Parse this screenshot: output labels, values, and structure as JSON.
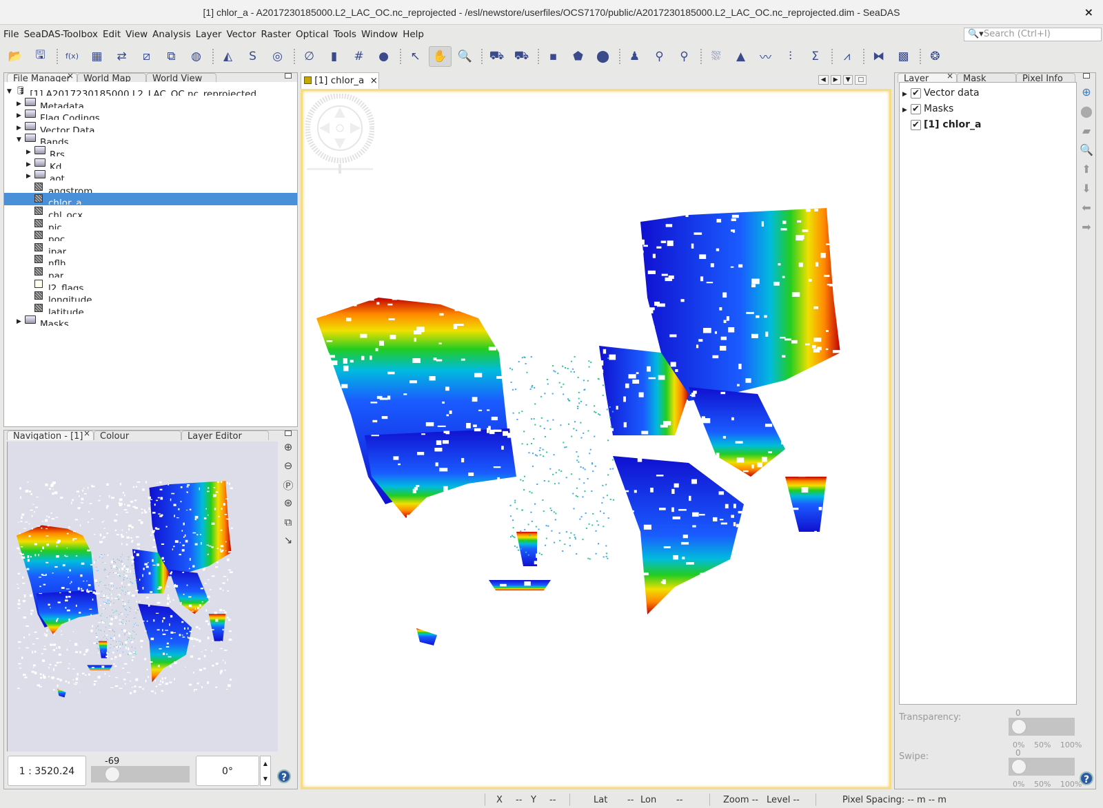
{
  "window": {
    "title": "[1] chlor_a - A2017230185000.L2_LAC_OC.nc_reprojected - /esl/newstore/userfiles/OCS7170/public/A2017230185000.L2_LAC_OC.nc_reprojected.dim - SeaDAS",
    "close": "×"
  },
  "menu": [
    "File",
    "SeaDAS-Toolbox",
    "Edit",
    "View",
    "Analysis",
    "Layer",
    "Vector",
    "Raster",
    "Optical",
    "Tools",
    "Window",
    "Help"
  ],
  "search": {
    "placeholder": "Search (Ctrl+I)"
  },
  "toolbar": [
    {
      "name": "open-product-icon",
      "glyph": "📂"
    },
    {
      "name": "save-product-icon",
      "glyph": "🖫"
    },
    {
      "sep": true
    },
    {
      "name": "band-maths-icon",
      "glyph": "f(x)"
    },
    {
      "name": "grid-icon",
      "glyph": "▦"
    },
    {
      "name": "transfer-icon",
      "glyph": "⇄"
    },
    {
      "name": "subset-icon",
      "glyph": "⧄"
    },
    {
      "name": "mosaic-icon",
      "glyph": "⧉"
    },
    {
      "name": "reproject-icon",
      "glyph": "◍"
    },
    {
      "sep": true
    },
    {
      "name": "land-mask-icon",
      "glyph": "◭"
    },
    {
      "name": "coastline-icon",
      "glyph": "S"
    },
    {
      "name": "contour-icon",
      "glyph": "◎"
    },
    {
      "sep": true
    },
    {
      "name": "no-data-icon",
      "glyph": "∅"
    },
    {
      "name": "color-bar-icon",
      "glyph": "▮"
    },
    {
      "name": "graticule-icon",
      "glyph": "#"
    },
    {
      "name": "world-icon",
      "glyph": "●"
    },
    {
      "sep": true
    },
    {
      "name": "select-tool-icon",
      "glyph": "↖"
    },
    {
      "name": "pan-tool-icon",
      "glyph": "✋",
      "selected": true
    },
    {
      "name": "zoom-tool-icon",
      "glyph": "🔍"
    },
    {
      "sep": true
    },
    {
      "name": "import-vector-icon",
      "glyph": "⛟"
    },
    {
      "name": "export-vector-icon",
      "glyph": "⛟"
    },
    {
      "sep": true
    },
    {
      "name": "draw-rectangle-icon",
      "glyph": "▪"
    },
    {
      "name": "draw-polygon-icon",
      "glyph": "⬟"
    },
    {
      "name": "draw-ellipse-icon",
      "glyph": "⬤"
    },
    {
      "sep": true
    },
    {
      "name": "magic-wand-icon",
      "glyph": "♟"
    },
    {
      "name": "pin-tool-icon",
      "glyph": "⚲"
    },
    {
      "name": "gcp-tool-icon",
      "glyph": "⚲"
    },
    {
      "sep": true
    },
    {
      "name": "scatter-plot-icon",
      "glyph": "⛆"
    },
    {
      "name": "histogram-icon",
      "glyph": "▲"
    },
    {
      "name": "profile-plot-icon",
      "glyph": "〰"
    },
    {
      "name": "spectrum-icon",
      "glyph": "⫶"
    },
    {
      "name": "statistics-icon",
      "glyph": "Σ"
    },
    {
      "sep": true
    },
    {
      "name": "information-icon",
      "glyph": "⩘"
    },
    {
      "sep": true
    },
    {
      "name": "graph-builder-icon",
      "glyph": "⧓"
    },
    {
      "name": "batch-processing-icon",
      "glyph": "▩"
    },
    {
      "sep": true
    },
    {
      "name": "rgb-image-icon",
      "glyph": "❂"
    }
  ],
  "left_top_tabs": [
    "File Manager",
    "World Map",
    "World View"
  ],
  "product_tree": [
    {
      "label": "[1] A2017230185000.L2_LAC_OC.nc_reprojected",
      "level": 0,
      "type": "product",
      "expanded": true
    },
    {
      "label": "Metadata",
      "level": 1,
      "type": "folder"
    },
    {
      "label": "Flag Codings",
      "level": 1,
      "type": "folder"
    },
    {
      "label": "Vector Data",
      "level": 1,
      "type": "folder"
    },
    {
      "label": "Bands",
      "level": 1,
      "type": "folder",
      "expanded": true
    },
    {
      "label": "Rrs",
      "level": 2,
      "type": "folder"
    },
    {
      "label": "Kd",
      "level": 2,
      "type": "folder"
    },
    {
      "label": "aot",
      "level": 2,
      "type": "folder"
    },
    {
      "label": "angstrom",
      "level": 2,
      "type": "band"
    },
    {
      "label": "chlor_a",
      "level": 2,
      "type": "band",
      "selected": true
    },
    {
      "label": "chl_ocx",
      "level": 2,
      "type": "band"
    },
    {
      "label": "pic",
      "level": 2,
      "type": "band"
    },
    {
      "label": "poc",
      "level": 2,
      "type": "band"
    },
    {
      "label": "ipar",
      "level": 2,
      "type": "band"
    },
    {
      "label": "nflh",
      "level": 2,
      "type": "band"
    },
    {
      "label": "par",
      "level": 2,
      "type": "band"
    },
    {
      "label": "l2_flags",
      "level": 2,
      "type": "flag"
    },
    {
      "label": "longitude",
      "level": 2,
      "type": "band"
    },
    {
      "label": "latitude",
      "level": 2,
      "type": "band"
    },
    {
      "label": "Masks",
      "level": 1,
      "type": "folder"
    }
  ],
  "left_bottom_tabs": [
    "Navigation - [1]",
    "Colour Manipulation",
    "Layer Editor"
  ],
  "navigation": {
    "scale": "1 : 3520.24",
    "zoom_slider_value": "-69",
    "rotation": "0°",
    "help": "?"
  },
  "image_view": {
    "tab_label": "[1] chlor_a",
    "close": "×"
  },
  "right_tabs": [
    "Layer Manager",
    "Mask Manager",
    "Pixel Info"
  ],
  "layers": [
    {
      "label": "Vector data",
      "checked": true,
      "expandable": true
    },
    {
      "label": "Masks",
      "checked": true,
      "expandable": true
    },
    {
      "label": "[1] chlor_a",
      "checked": true,
      "bold": true
    }
  ],
  "layer_controls": {
    "transparency_label": "Transparency:",
    "transparency_value": "0",
    "swipe_label": "Swipe:",
    "swipe_value": "0",
    "ticks": [
      "0%",
      "50%",
      "100%"
    ]
  },
  "status": {
    "x": "X",
    "x_val": "--",
    "y": "Y",
    "y_val": "--",
    "lat": "Lat",
    "lat_val": "--",
    "lon": "Lon",
    "lon_val": "--",
    "zoom": "Zoom --",
    "level": "Level --",
    "pixel_spacing": "Pixel Spacing: -- m -- m"
  },
  "colors": {
    "selection": "#4a90d9",
    "view_border": "#f5d56a",
    "nav_bg": "#dddde9"
  }
}
